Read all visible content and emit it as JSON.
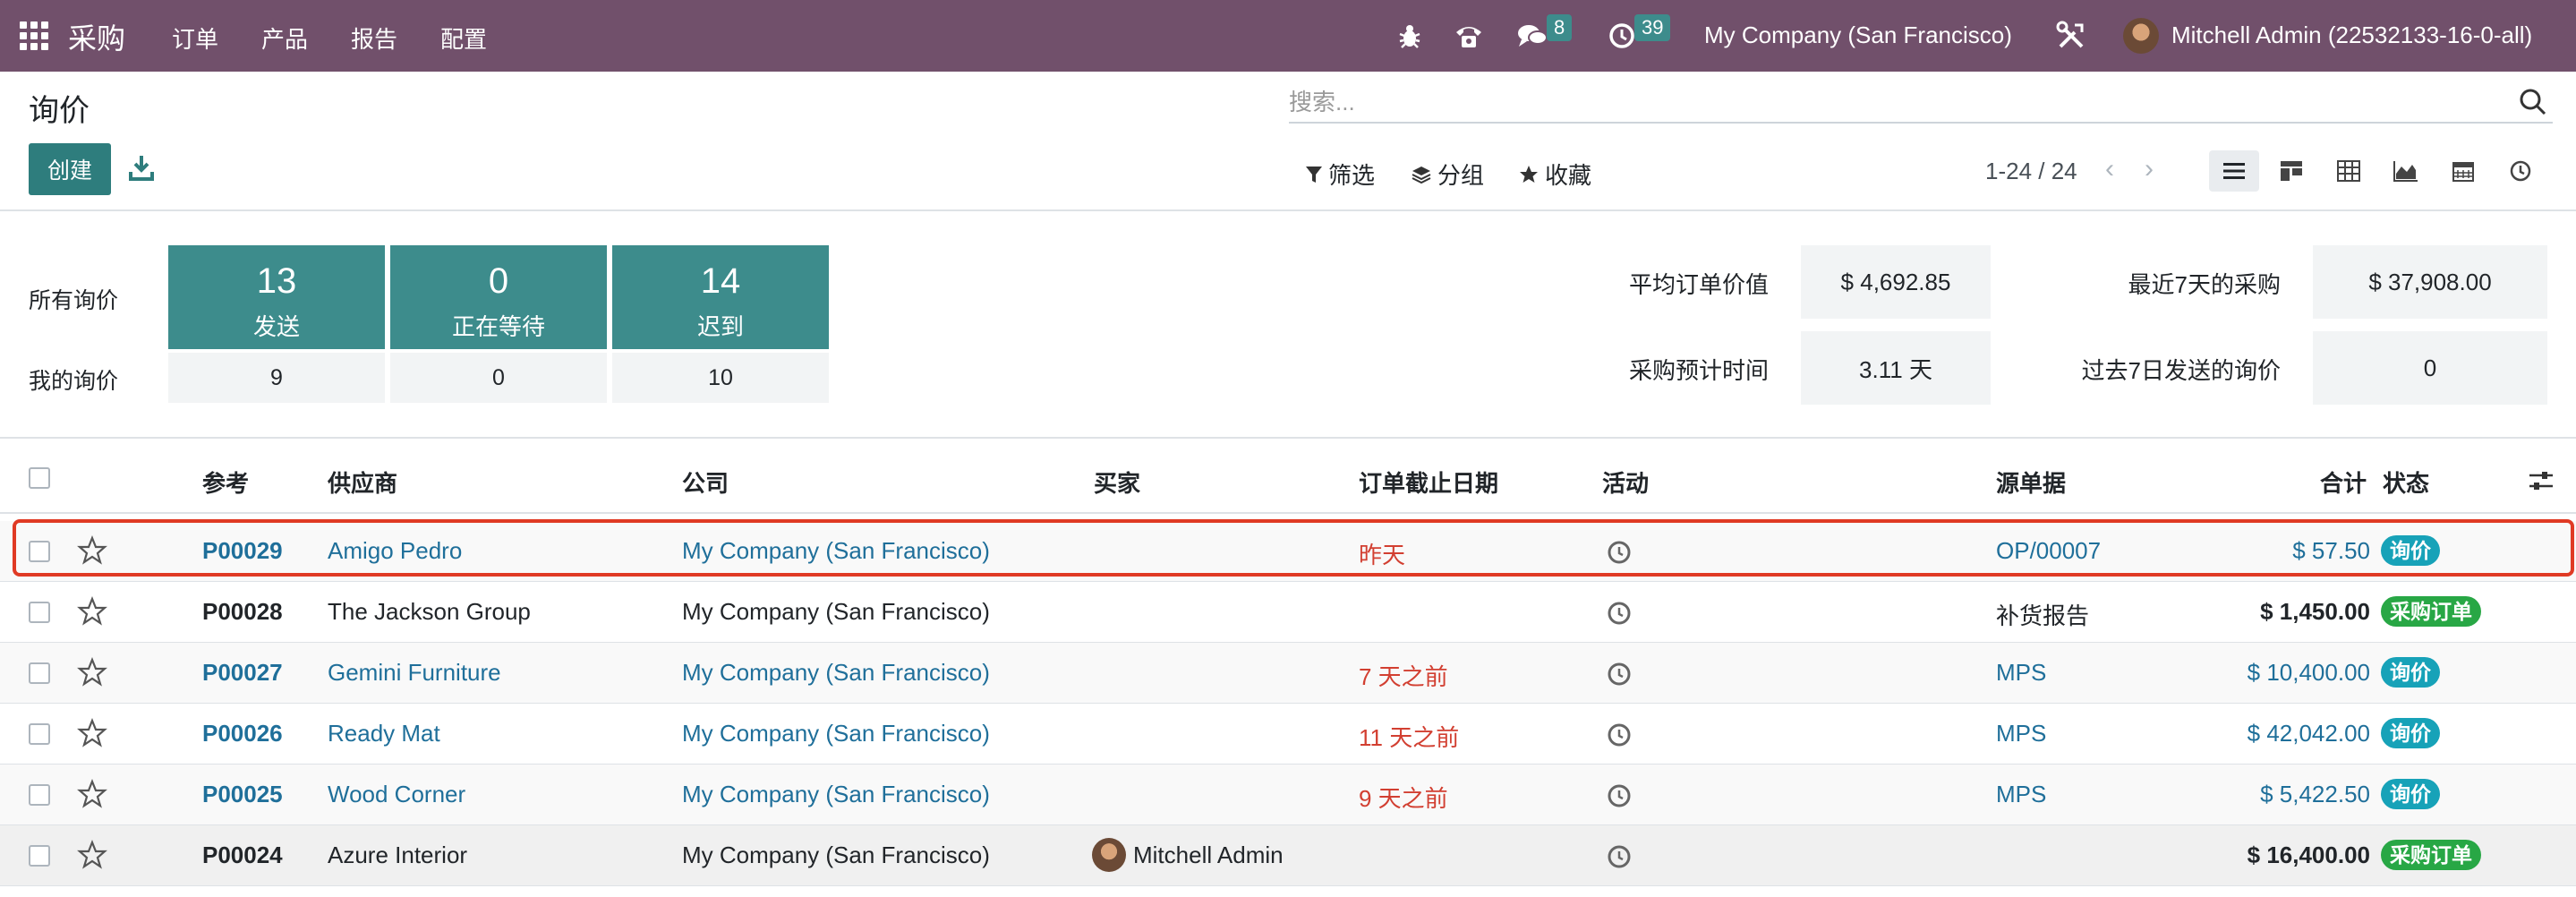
{
  "navbar": {
    "app_name": "采购",
    "menus": [
      "订单",
      "产品",
      "报告",
      "配置"
    ],
    "messages_count": "8",
    "activities_count": "39",
    "company": "My Company (San Francisco)",
    "user": "Mitchell Admin (22532133-16-0-all)",
    "bg_color": "#71506b"
  },
  "control": {
    "title": "询价",
    "create_label": "创建",
    "search_placeholder": "搜索...",
    "filter_label": "筛选",
    "group_label": "分组",
    "favorite_label": "收藏",
    "pager": "1-24 / 24"
  },
  "dashboard": {
    "all_rfq_label": "所有询价",
    "my_rfq_label": "我的询价",
    "tiles": [
      {
        "num": "13",
        "label": "发送",
        "mine": "9"
      },
      {
        "num": "0",
        "label": "正在等待",
        "mine": "0"
      },
      {
        "num": "14",
        "label": "迟到",
        "mine": "10"
      }
    ],
    "stats": {
      "avg_label": "平均订单价值",
      "avg_value": "$ 4,692.85",
      "last7_label": "最近7天的采购",
      "last7_value": "$ 37,908.00",
      "lead_label": "采购预计时间",
      "lead_value": "3.11 天",
      "sent7_label": "过去7日发送的询价",
      "sent7_value": "0"
    }
  },
  "table": {
    "headers": {
      "ref": "参考",
      "vendor": "供应商",
      "company": "公司",
      "buyer": "买家",
      "deadline": "订单截止日期",
      "activity": "活动",
      "source": "源单据",
      "total": "合计",
      "status": "状态"
    },
    "rows": [
      {
        "ref": "P00029",
        "vendor": "Amigo Pedro",
        "company": "My Company (San Francisco)",
        "buyer": "",
        "deadline": "昨天",
        "source": "OP/00007",
        "total": "$ 57.50",
        "status": "询价"
      },
      {
        "ref": "P00028",
        "vendor": "The Jackson Group",
        "company": "My Company (San Francisco)",
        "buyer": "",
        "deadline": "",
        "source": "补货报告",
        "total": "$ 1,450.00",
        "status": "采购订单"
      },
      {
        "ref": "P00027",
        "vendor": "Gemini Furniture",
        "company": "My Company (San Francisco)",
        "buyer": "",
        "deadline": "7 天之前",
        "source": "MPS",
        "total": "$ 10,400.00",
        "status": "询价"
      },
      {
        "ref": "P00026",
        "vendor": "Ready Mat",
        "company": "My Company (San Francisco)",
        "buyer": "",
        "deadline": "11 天之前",
        "source": "MPS",
        "total": "$ 42,042.00",
        "status": "询价"
      },
      {
        "ref": "P00025",
        "vendor": "Wood Corner",
        "company": "My Company (San Francisco)",
        "buyer": "",
        "deadline": "9 天之前",
        "source": "MPS",
        "total": "$ 5,422.50",
        "status": "询价"
      },
      {
        "ref": "P00024",
        "vendor": "Azure Interior",
        "company": "My Company (San Francisco)",
        "buyer": "Mitchell Admin",
        "deadline": "",
        "source": "",
        "total": "$ 16,400.00",
        "status": "采购订单"
      }
    ]
  }
}
